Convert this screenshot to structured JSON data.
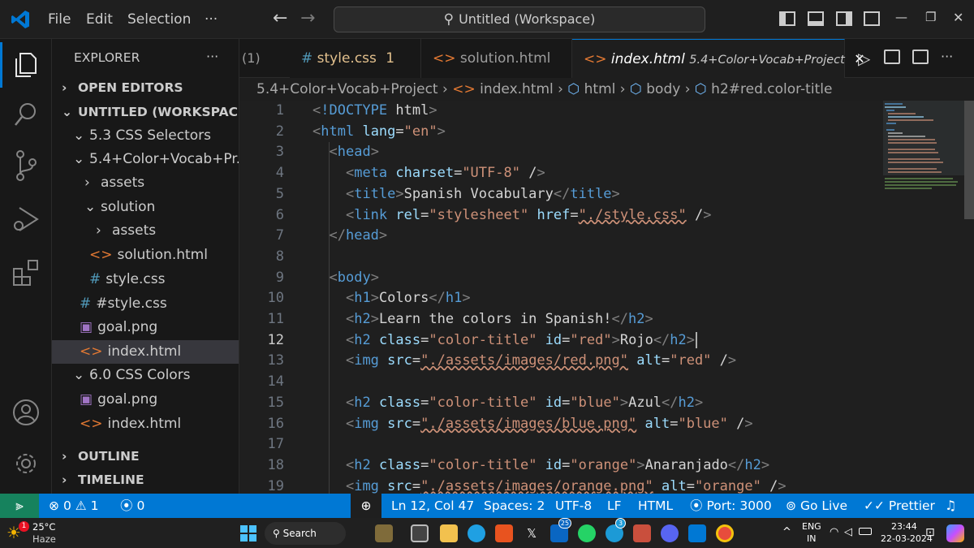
{
  "titlebar": {
    "menus": [
      "File",
      "Edit",
      "Selection",
      "···"
    ],
    "search_text": "Untitled (Workspace)"
  },
  "sidebar": {
    "title": "EXPLORER",
    "more": "···",
    "rows": [
      {
        "label": "OPEN EDITORS",
        "chev": "›",
        "icon": "",
        "kind": "section"
      },
      {
        "label": "UNTITLED (WORKSPACE)",
        "chev": "⌄",
        "icon": "",
        "kind": "section"
      },
      {
        "label": "5.3 CSS Selectors",
        "chev": "⌄",
        "icon": "",
        "kind": "folder"
      },
      {
        "label": "5.4+Color+Vocab+Pr...",
        "chev": "⌄",
        "icon": "",
        "kind": "folder"
      },
      {
        "label": "assets",
        "chev": "›",
        "icon": "",
        "kind": "folder"
      },
      {
        "label": "solution",
        "chev": "⌄",
        "icon": "",
        "kind": "folder"
      },
      {
        "label": "assets",
        "chev": "›",
        "icon": "",
        "kind": "folder"
      },
      {
        "label": "solution.html",
        "chev": "",
        "icon": "<>",
        "kind": "html"
      },
      {
        "label": "style.css",
        "chev": "",
        "icon": "#",
        "kind": "css"
      },
      {
        "label": "#style.css",
        "chev": "",
        "icon": "#",
        "kind": "css"
      },
      {
        "label": "goal.png",
        "chev": "",
        "icon": "▣",
        "kind": "img"
      },
      {
        "label": "index.html",
        "chev": "",
        "icon": "<>",
        "kind": "html"
      },
      {
        "label": "6.0 CSS Colors",
        "chev": "⌄",
        "icon": "",
        "kind": "folder"
      },
      {
        "label": "goal.png",
        "chev": "",
        "icon": "▣",
        "kind": "img"
      },
      {
        "label": "index.html",
        "chev": "",
        "icon": "<>",
        "kind": "html"
      },
      {
        "label": "OUTLINE",
        "chev": "›",
        "icon": "",
        "kind": "section"
      },
      {
        "label": "TIMELINE",
        "chev": "›",
        "icon": "",
        "kind": "section"
      }
    ]
  },
  "tabs": {
    "overflow_label": "(1)",
    "items": [
      {
        "icon": "#",
        "label": "style.css",
        "badge": "1"
      },
      {
        "icon": "<>",
        "label": "solution.html",
        "badge": ""
      },
      {
        "icon": "<>",
        "label": "index.html",
        "badge": "5.4+Color+Vocab+Project"
      }
    ],
    "close": "✕",
    "more": "···"
  },
  "breadcrumb": {
    "items": [
      "5.4+Color+Vocab+Project",
      "index.html",
      "html",
      "body",
      "h2#red.color-title"
    ],
    "separator": "›"
  },
  "editor": {
    "line_numbers": [
      "1",
      "2",
      "3",
      "4",
      "5",
      "6",
      "7",
      "8",
      "9",
      "10",
      "11",
      "12",
      "13",
      "14",
      "15",
      "16",
      "17",
      "18",
      "19"
    ],
    "current_line": "12",
    "lines": [
      "<!DOCTYPE html>",
      "<html lang=\"en\">",
      "  <head>",
      "    <meta charset=\"UTF-8\" />",
      "    <title>Spanish Vocabulary</title>",
      "    <link rel=\"stylesheet\" href=\"./style.css\" />",
      "  </head>",
      "",
      "  <body>",
      "    <h1>Colors</h1>",
      "    <h2>Learn the colors in Spanish!</h2>",
      "    <h2 class=\"color-title\" id=\"red\">Rojo</h2>",
      "    <img src=\"./assets/images/red.png\" alt=\"red\" />",
      "",
      "    <h2 class=\"color-title\" id=\"blue\">Azul</h2>",
      "    <img src=\"./assets/images/blue.png\" alt=\"blue\" />",
      "",
      "    <h2 class=\"color-title\" id=\"orange\">Anaranjado</h2>",
      "    <img src=\"./assets/images/orange.png\" alt=\"orange\" />"
    ]
  },
  "statusbar": {
    "errors": "0",
    "warnings": "1",
    "ports": "0",
    "position": "Ln 12, Col 47",
    "spaces": "Spaces: 2",
    "encoding": "UTF-8",
    "eol": "LF",
    "language": "HTML",
    "port": "Port: 3000",
    "go_live": "Go Live",
    "prettier": "Prettier"
  },
  "taskbar": {
    "weather_temp": "25°C",
    "weather_desc": "Haze",
    "weather_badge": "1",
    "search_label": "Search",
    "lang": "ENG",
    "region": "IN",
    "time": "23:44",
    "date": "22-03-2024",
    "linkedin_badge": "25",
    "whatsapp_badge": "3"
  },
  "colors": {
    "accent": "#0078d4",
    "background": "#1e1e1e",
    "tag": "#569cd6",
    "attribute": "#9cdcfe",
    "string": "#ce9178"
  }
}
